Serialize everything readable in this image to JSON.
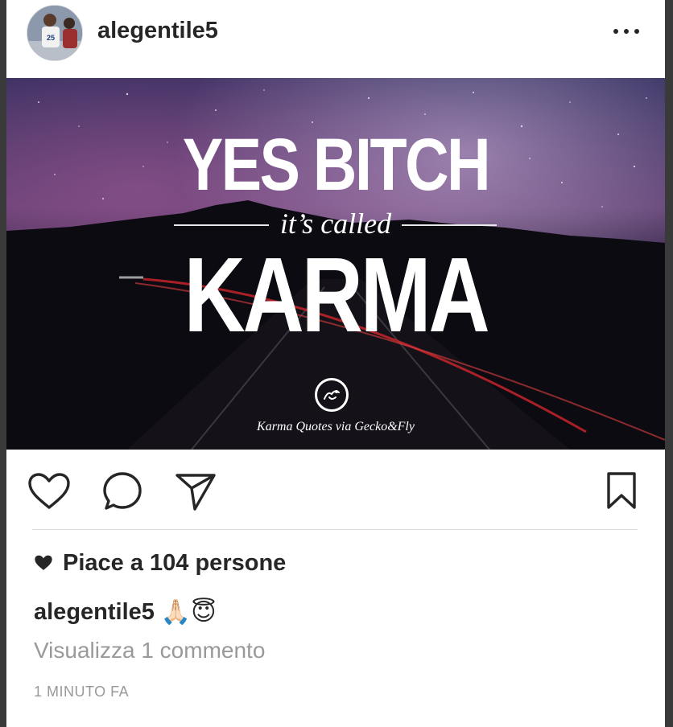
{
  "post": {
    "username": "alegentile5",
    "more_icon": "more-horizontal-icon",
    "image": {
      "line1": "YES BITCH",
      "line2": "it’s called",
      "line3": "KARMA",
      "credit": "Karma Quotes via Gecko&Fly"
    },
    "actions": {
      "like_icon": "heart-outline-icon",
      "comment_icon": "comment-bubble-icon",
      "share_icon": "paper-plane-icon",
      "save_icon": "bookmark-icon"
    },
    "likes_text": "Piace a 104 persone",
    "caption": {
      "username": "alegentile5",
      "emoji": "🙏🏻😇"
    },
    "view_comments": "Visualizza 1 commento",
    "timestamp": "1 MINUTO FA"
  }
}
